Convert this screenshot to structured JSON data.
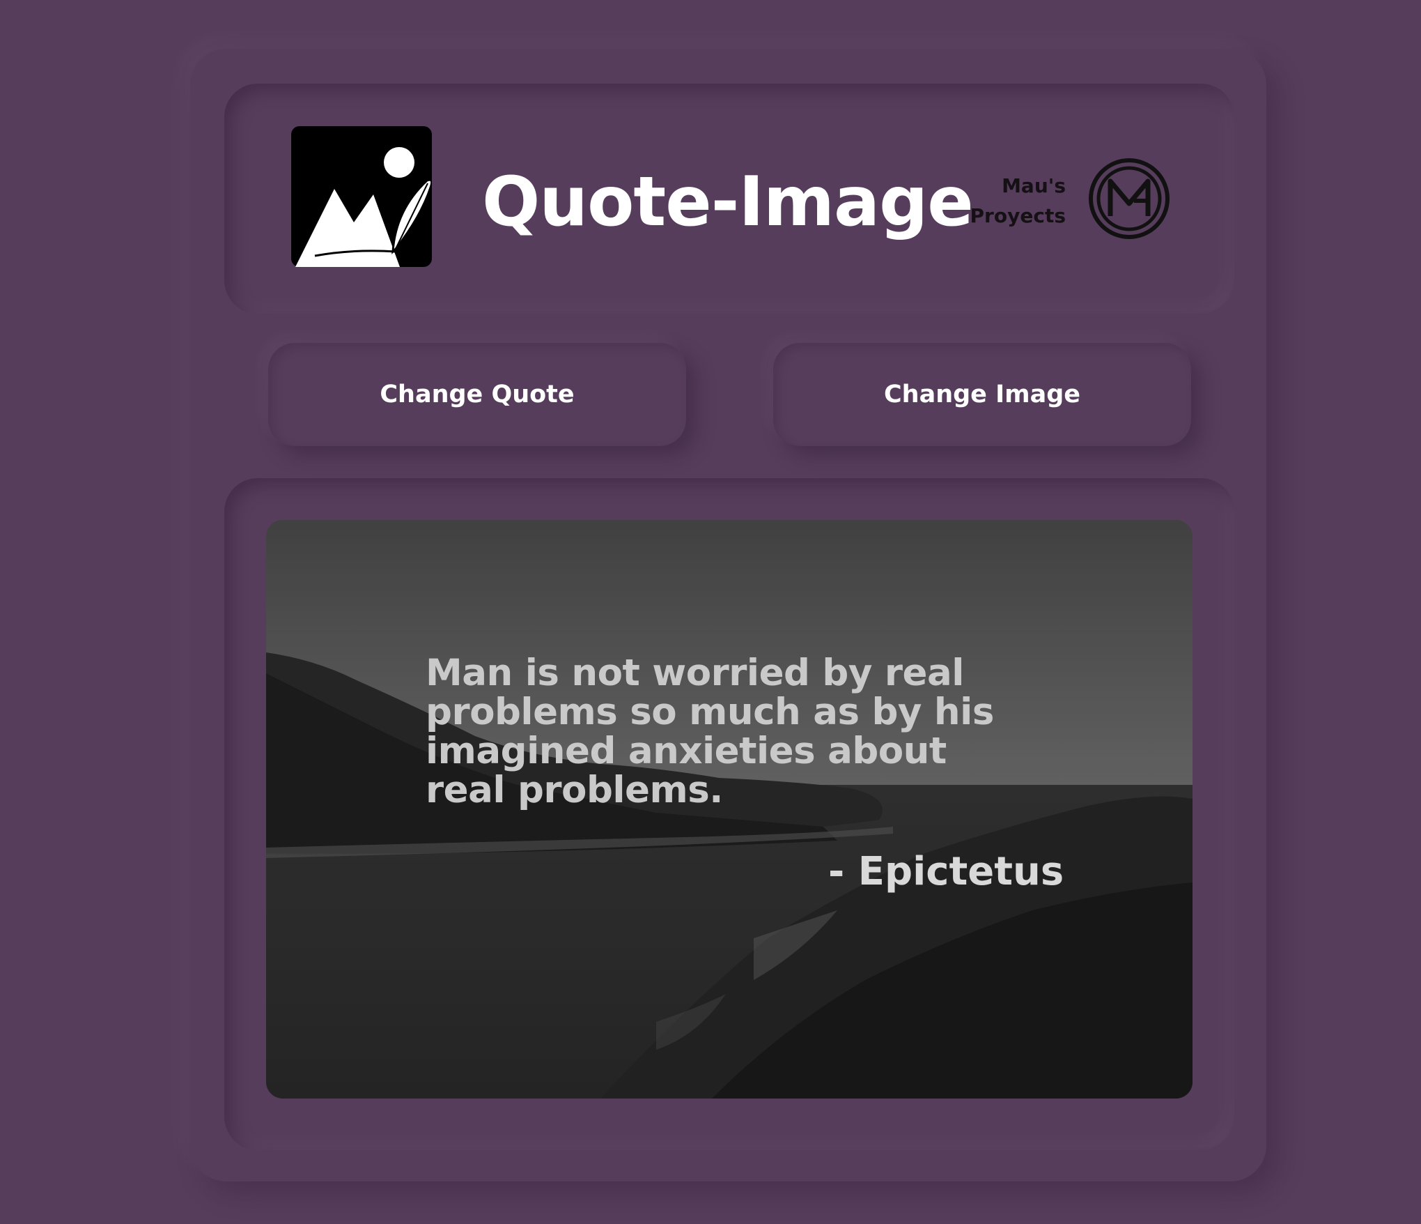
{
  "header": {
    "title": "Quote-Image",
    "brand_line1": "Mau's",
    "brand_line2": "Proyects",
    "app_logo_icon": "image-with-quill-icon",
    "brand_logo_icon": "mg-monogram-logo"
  },
  "actions": {
    "change_quote_label": "Change Quote",
    "change_image_label": "Change Image"
  },
  "quote": {
    "text": "Man is not worried by real problems so much as by his imagined anxieties about real problems.",
    "author": "- Epictetus"
  },
  "colors": {
    "background": "#573d5c",
    "title_text": "#ffffff",
    "brand_text": "#141014",
    "quote_text": "#c9c9c9"
  }
}
